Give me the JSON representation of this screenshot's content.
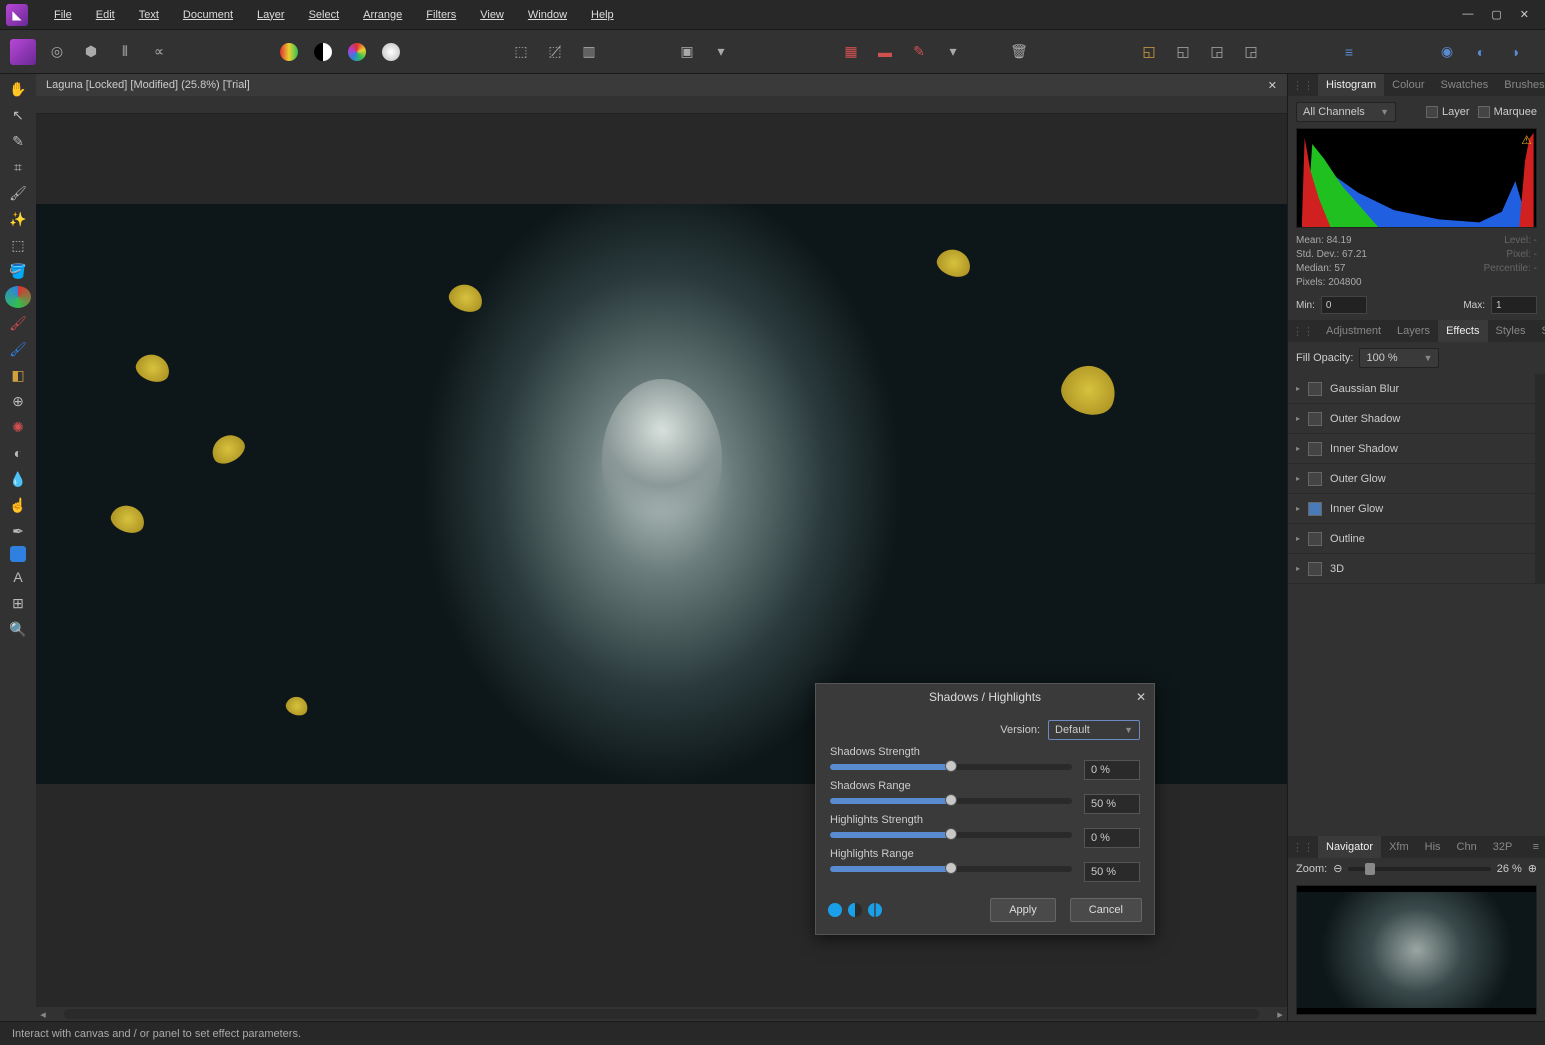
{
  "menu": {
    "items": [
      "File",
      "Edit",
      "Text",
      "Document",
      "Layer",
      "Select",
      "Arrange",
      "Filters",
      "View",
      "Window",
      "Help"
    ]
  },
  "document": {
    "tab_title": "Laguna [Locked] [Modified] (25.8%) [Trial]"
  },
  "panels": {
    "top_tabs": [
      "Histogram",
      "Colour",
      "Swatches",
      "Brushes"
    ],
    "top_active": 0,
    "mid_tabs": [
      "Adjustment",
      "Layers",
      "Effects",
      "Styles",
      "Stock"
    ],
    "mid_active": 2,
    "bottom_tabs": [
      "Navigator",
      "Xfm",
      "His",
      "Chn",
      "32P"
    ],
    "bottom_active": 0
  },
  "histogram": {
    "channel_label": "All Channels",
    "layer_label": "Layer",
    "marquee_label": "Marquee",
    "stats": {
      "mean_label": "Mean:",
      "mean": "84.19",
      "std_label": "Std. Dev.:",
      "std": "67.21",
      "median_label": "Median:",
      "median": "57",
      "pixels_label": "Pixels:",
      "pixels": "204800",
      "level_label": "Level:",
      "level": "-",
      "pixel2_label": "Pixel:",
      "pixel2": "-",
      "percentile_label": "Percentile:",
      "percentile": "-"
    },
    "min_label": "Min:",
    "min_value": "0",
    "max_label": "Max:",
    "max_value": "1"
  },
  "effects": {
    "opacity_label": "Fill Opacity:",
    "opacity_value": "100 %",
    "items": [
      {
        "label": "Gaussian Blur",
        "on": false
      },
      {
        "label": "Outer Shadow",
        "on": false
      },
      {
        "label": "Inner Shadow",
        "on": false
      },
      {
        "label": "Outer Glow",
        "on": false
      },
      {
        "label": "Inner Glow",
        "on": true
      },
      {
        "label": "Outline",
        "on": false
      },
      {
        "label": "3D",
        "on": false
      }
    ]
  },
  "navigator": {
    "zoom_label": "Zoom:",
    "zoom_value": "26 %"
  },
  "dialog": {
    "title": "Shadows / Highlights",
    "version_label": "Version:",
    "version_value": "Default",
    "rows": [
      {
        "label": "Shadows Strength",
        "value": "0 %",
        "pct": 50
      },
      {
        "label": "Shadows Range",
        "value": "50 %",
        "pct": 50
      },
      {
        "label": "Highlights Strength",
        "value": "0 %",
        "pct": 50
      },
      {
        "label": "Highlights Range",
        "value": "50 %",
        "pct": 50
      }
    ],
    "apply_label": "Apply",
    "cancel_label": "Cancel"
  },
  "status": {
    "text": "Interact with canvas and / or panel to set effect parameters."
  }
}
